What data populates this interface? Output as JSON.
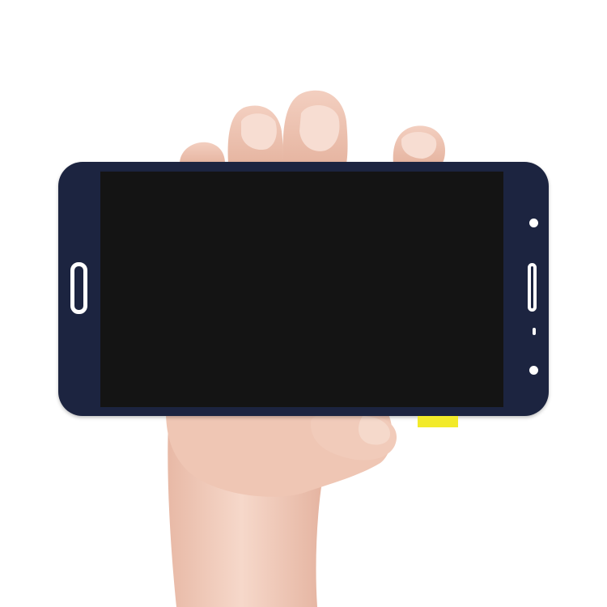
{
  "image": {
    "colors": {
      "background": "#ffffff",
      "bezel": "#1c2440",
      "screen": "#141414",
      "skin": "#f0c9b8",
      "label": "#f2ea2a"
    },
    "elements": {
      "hand": "hand-holding-display",
      "display_panel": "lcd-touch-screen-assembly",
      "home_key": "home-button-cutout",
      "earpiece": "earpiece-slot",
      "sensors": "sensor-holes"
    }
  }
}
